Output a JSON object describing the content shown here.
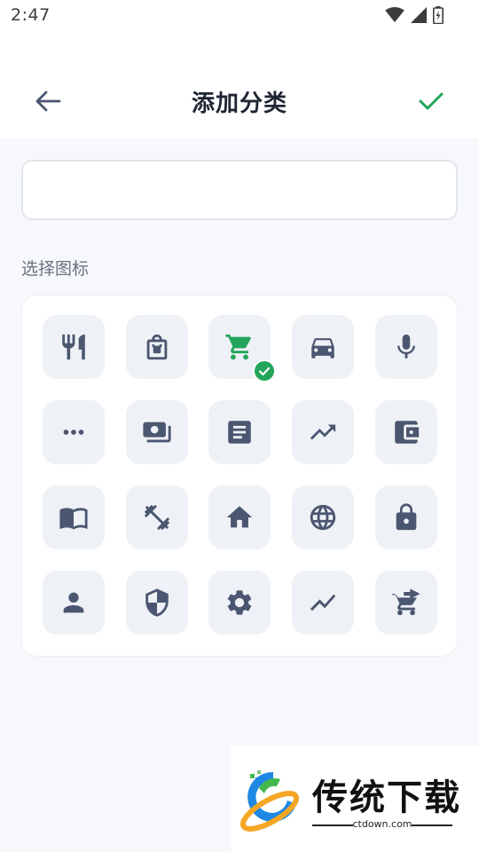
{
  "status_bar": {
    "time": "2:47"
  },
  "appbar": {
    "title": "添加分类"
  },
  "form": {
    "name_value": "",
    "name_placeholder": ""
  },
  "section": {
    "label": "选择图标"
  },
  "icons": [
    {
      "name": "restaurant-icon",
      "selected": false
    },
    {
      "name": "shopping-bag-icon",
      "selected": false
    },
    {
      "name": "shopping-cart-icon",
      "selected": true
    },
    {
      "name": "car-icon",
      "selected": false
    },
    {
      "name": "microphone-icon",
      "selected": false
    },
    {
      "name": "more-horizontal-icon",
      "selected": false
    },
    {
      "name": "money-icon",
      "selected": false
    },
    {
      "name": "article-icon",
      "selected": false
    },
    {
      "name": "trending-up-icon",
      "selected": false
    },
    {
      "name": "wallet-icon",
      "selected": false
    },
    {
      "name": "book-icon",
      "selected": false
    },
    {
      "name": "fitness-icon",
      "selected": false
    },
    {
      "name": "home-icon",
      "selected": false
    },
    {
      "name": "globe-icon",
      "selected": false
    },
    {
      "name": "lock-icon",
      "selected": false
    },
    {
      "name": "person-icon",
      "selected": false
    },
    {
      "name": "shield-icon",
      "selected": false
    },
    {
      "name": "settings-icon",
      "selected": false
    },
    {
      "name": "show-chart-icon",
      "selected": false
    },
    {
      "name": "cart-arrow-icon",
      "selected": false
    }
  ],
  "colors": {
    "accent": "#22a55a",
    "icon_default": "#4b5670",
    "tile_bg": "#eef1f6",
    "page_bg": "#f7f8fb"
  },
  "watermark": {
    "text": "传统下载",
    "url": "ctdown.com"
  }
}
